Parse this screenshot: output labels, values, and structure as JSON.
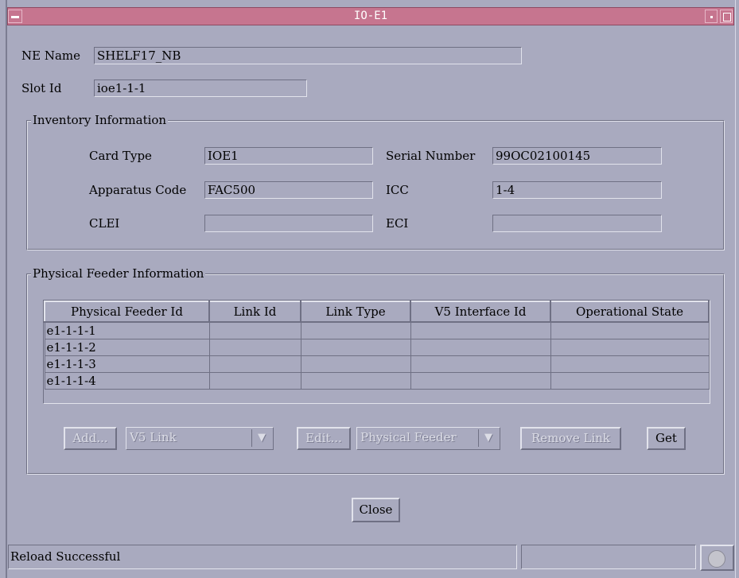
{
  "window": {
    "title": "IO-E1"
  },
  "ne_name": {
    "label": "NE Name",
    "value": "SHELF17_NB"
  },
  "slot_id": {
    "label": "Slot Id",
    "value": "ioe1-1-1"
  },
  "inventory": {
    "title": "Inventory Information",
    "card_type": {
      "label": "Card Type",
      "value": "IOE1"
    },
    "apparatus_code": {
      "label": "Apparatus Code",
      "value": "FAC500"
    },
    "clei": {
      "label": "CLEI",
      "value": ""
    },
    "serial_number": {
      "label": "Serial Number",
      "value": "99OC02100145"
    },
    "icc": {
      "label": "ICC",
      "value": "1-4"
    },
    "eci": {
      "label": "ECI",
      "value": ""
    }
  },
  "feeder": {
    "title": "Physical Feeder Information",
    "columns": [
      "Physical Feeder Id",
      "Link Id",
      "Link Type",
      "V5 Interface Id",
      "Operational State"
    ],
    "rows": [
      [
        "e1-1-1-1",
        "",
        "",
        "",
        ""
      ],
      [
        "e1-1-1-2",
        "",
        "",
        "",
        ""
      ],
      [
        "e1-1-1-3",
        "",
        "",
        "",
        ""
      ],
      [
        "e1-1-1-4",
        "",
        "",
        "",
        ""
      ]
    ],
    "add_label": "Add...",
    "link_type_selected": "V5 Link",
    "edit_label": "Edit...",
    "edit_target_selected": "Physical Feeder",
    "remove_label": "Remove Link",
    "get_label": "Get"
  },
  "close_label": "Close",
  "status": {
    "message": "Reload Successful",
    "secondary": "",
    "icon": "stop-hand-icon"
  },
  "colors": {
    "background": "#a9aabf",
    "titlebar": "#c6758f"
  }
}
